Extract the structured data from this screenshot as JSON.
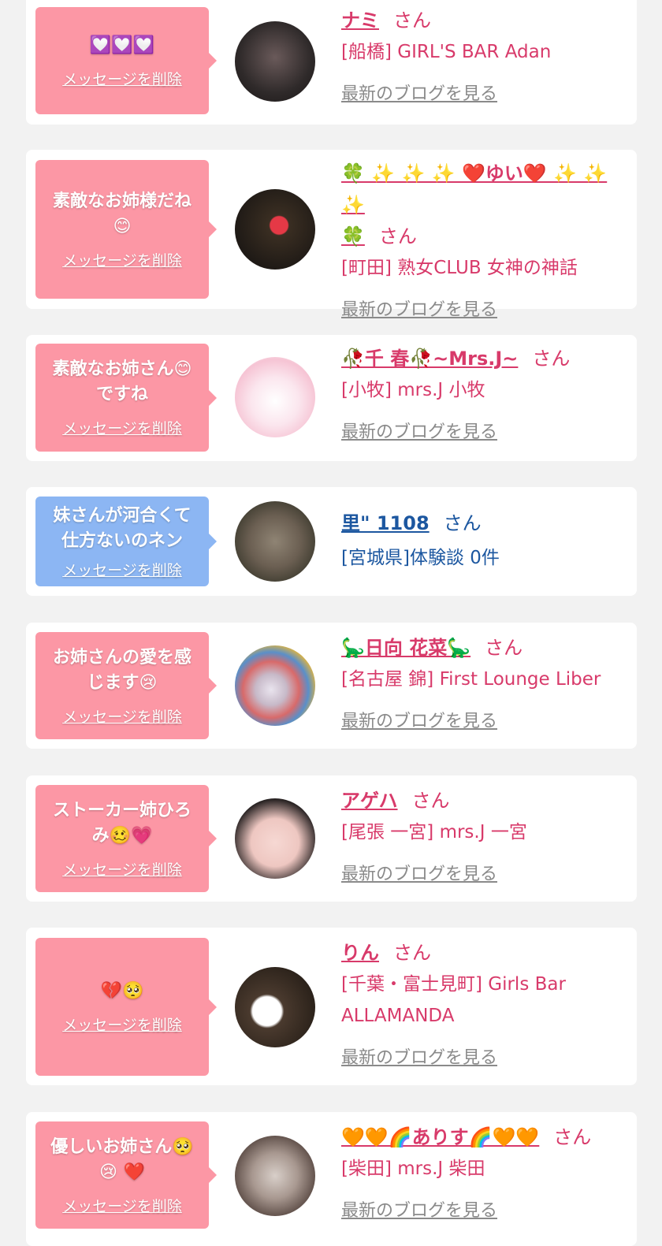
{
  "common": {
    "delete_label": "メッセージを削除",
    "blog_label": "最新のブログを見る",
    "san": "さん"
  },
  "cards": [
    {
      "message": "💟💟💟",
      "name": "ナミ",
      "shop": "[船橋] GIRL'S BAR Adan"
    },
    {
      "message": "素敵なお姉様だね",
      "message_emoji": "😊",
      "name": "🍀 ✨ ✨ ✨ ❤️ゆい❤️ ✨ ✨ ✨",
      "name_2": "🍀",
      "shop": "[町田] 熟女CLUB 女神の神話"
    },
    {
      "message": "素敵なお姉さん😊",
      "message_2": "ですね",
      "name": "🥀千 春🥀~Mrs.J~",
      "shop": "[小牧] mrs.J 小牧"
    },
    {
      "message": "妹さんが河合くて",
      "message_2": "仕方ないのネン",
      "name": "里\" 1108",
      "shop": "[宮城県]体験談 0件"
    },
    {
      "message": "お姉さんの愛を感",
      "message_2": "じます😢",
      "name": "🦕日向 花菜🦕",
      "shop": "[名古屋 錦] First Lounge Liber"
    },
    {
      "message": "ストーカー姉ひろ",
      "message_2": "み🥴💗",
      "name": "アゲハ",
      "shop": "[尾張 一宮] mrs.J 一宮"
    },
    {
      "message": "💔🥺",
      "name": "りん",
      "shop": "[千葉・富士見町] Girls Bar",
      "shop_2": "ALLAMANDA"
    },
    {
      "message": "優しいお姉さん🥺",
      "message_2": "😢 ❤️",
      "name": "🧡🧡🌈ありす🌈🧡🧡",
      "shop": "[柴田] mrs.J 柴田"
    }
  ],
  "colors": {
    "pink_bubble": "#fc97a5",
    "blue_bubble": "#8cb6f3",
    "pink_text": "#d83a6a",
    "blue_text": "#1c57a0",
    "blog_link": "#8a8a8a"
  }
}
